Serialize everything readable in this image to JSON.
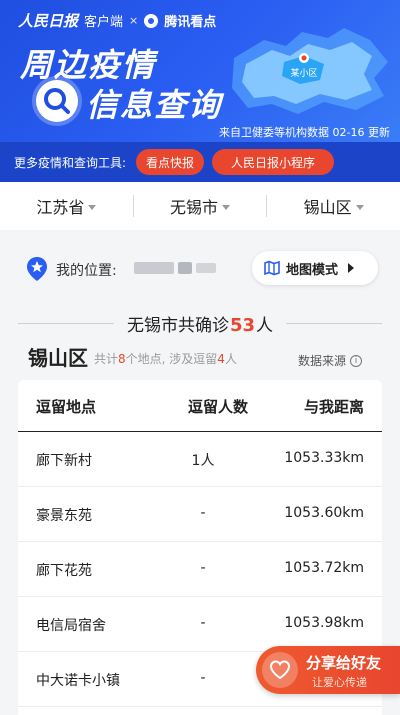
{
  "header": {
    "brand_rmrb": "人民日报",
    "brand_client": "客户端",
    "brand_x": "×",
    "brand_tencent": "腾讯看点",
    "title_line1": "周边疫情",
    "title_line2": "信息查询",
    "map_label": "某小区",
    "data_source": "来自卫健委等机构数据 02-16 更新"
  },
  "tools": {
    "label": "更多疫情和查询工具:",
    "btn_news": "看点快报",
    "btn_miniprogram": "人民日报小程序"
  },
  "region": {
    "province": "江苏省",
    "city": "无锡市",
    "district": "锡山区"
  },
  "location": {
    "label": "我的位置:",
    "map_mode": "地图模式"
  },
  "summary": {
    "prefix": "无锡市共确诊",
    "count": "53",
    "suffix": "人"
  },
  "district": {
    "name": "锡山区",
    "sub_prefix": "共计",
    "places": "8",
    "sub_mid": "个地点, 涉及逗留",
    "people": "4",
    "sub_suffix": "人",
    "data_source_label": "数据来源",
    "info_glyph": "i"
  },
  "table": {
    "headers": [
      "逗留地点",
      "逗留人数",
      "与我距离"
    ],
    "rows": [
      [
        "廊下新村",
        "1人",
        "1053.33km"
      ],
      [
        "豪景东苑",
        "-",
        "1053.60km"
      ],
      [
        "廊下花苑",
        "-",
        "1053.72km"
      ],
      [
        "电信局宿舍",
        "-",
        "1053.98km"
      ],
      [
        "中大诺卡小镇",
        "-",
        ""
      ]
    ]
  },
  "share": {
    "title": "分享给好友",
    "subtitle": "让爱心传递"
  },
  "colors": {
    "brand_blue": "#2a5df2",
    "accent_red": "#e8462e"
  }
}
